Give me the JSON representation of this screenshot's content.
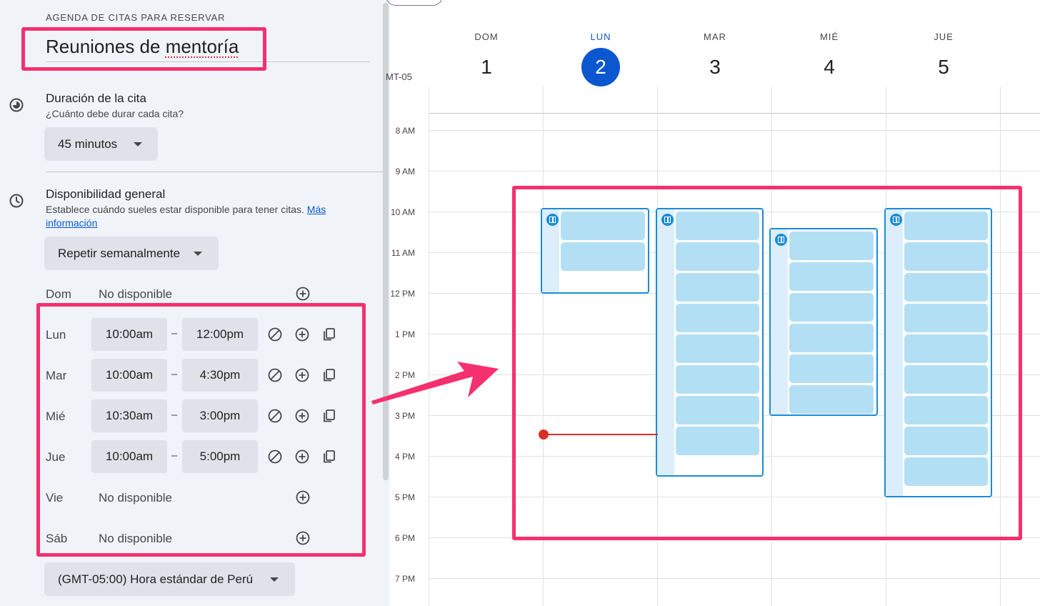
{
  "panel": {
    "eyebrow": "AGENDA DE CITAS PARA RESERVAR",
    "title_part1": "Reuniones de ",
    "title_part2": "mentoría",
    "duration": {
      "title": "Duración de la cita",
      "subtitle": "¿Cuánto debe durar cada cita?",
      "value": "45 minutos",
      "icon": "timelapse-icon"
    },
    "availability": {
      "title": "Disponibilidad general",
      "subtitle": "Establece cuándo sueles estar disponible para tener citas.",
      "link1": "Más",
      "link2": "información",
      "repeat": "Repetir semanalmente",
      "icon": "clock-icon"
    },
    "days": [
      {
        "day": "Dom",
        "status": "No disponible"
      },
      {
        "day": "Lun",
        "start": "10:00am",
        "end": "12:00pm"
      },
      {
        "day": "Mar",
        "start": "10:00am",
        "end": "4:30pm"
      },
      {
        "day": "Mié",
        "start": "10:30am",
        "end": "3:00pm"
      },
      {
        "day": "Jue",
        "start": "10:00am",
        "end": "5:00pm"
      },
      {
        "day": "Vie",
        "status": "No disponible"
      },
      {
        "day": "Sáb",
        "status": "No disponible"
      }
    ],
    "range_separator": "–",
    "timezone": "(GMT-05:00) Hora estándar de Perú"
  },
  "calendar": {
    "timezone_label": "MT-05",
    "days": [
      {
        "name": "DOM",
        "date": "1"
      },
      {
        "name": "LUN",
        "date": "2"
      },
      {
        "name": "MAR",
        "date": "3"
      },
      {
        "name": "MIÉ",
        "date": "4"
      },
      {
        "name": "JUE",
        "date": "5"
      }
    ],
    "hours": [
      "8 AM",
      "9 AM",
      "10 AM",
      "11 AM",
      "12 PM",
      "1 PM",
      "2 PM",
      "3 PM",
      "4 PM",
      "5 PM",
      "6 PM",
      "7 PM"
    ],
    "today_index": 1,
    "colors": {
      "accent": "#0b57d0",
      "slot": "#b3dff5",
      "slot_border": "#1a8bd8",
      "highlight": "#f5306f",
      "now": "#d93025"
    }
  }
}
